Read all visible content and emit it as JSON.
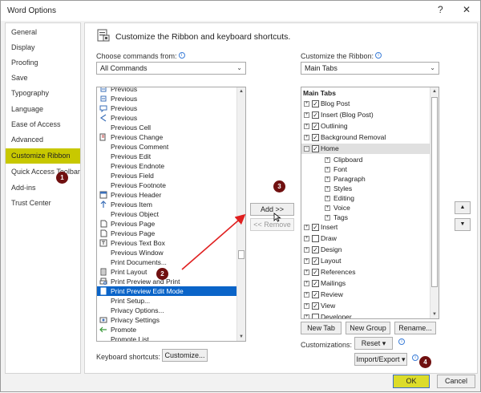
{
  "window": {
    "title": "Word Options",
    "help_label": "?",
    "close_label": "✕"
  },
  "nav": {
    "items": [
      {
        "label": "General"
      },
      {
        "label": "Display"
      },
      {
        "label": "Proofing"
      },
      {
        "label": "Save"
      },
      {
        "label": "Typography"
      },
      {
        "label": "Language"
      },
      {
        "label": "Ease of Access"
      },
      {
        "label": "Advanced"
      },
      {
        "label": "Customize Ribbon",
        "active": true
      },
      {
        "label": "Quick Access Toolbar"
      },
      {
        "label": "Add-ins"
      },
      {
        "label": "Trust Center"
      }
    ]
  },
  "header": {
    "title": "Customize the Ribbon and keyboard shortcuts."
  },
  "left": {
    "label": "Choose commands from:",
    "dropdown_value": "All Commands",
    "commands": [
      {
        "label": "Previous",
        "icon": "prev-icon"
      },
      {
        "label": "Previous",
        "icon": "prev-icon"
      },
      {
        "label": "Previous",
        "icon": "comment-prev-icon"
      },
      {
        "label": "Previous",
        "icon": "triangle-prev-icon"
      },
      {
        "label": "Previous Cell",
        "icon": ""
      },
      {
        "label": "Previous Change",
        "icon": "change-prev-icon"
      },
      {
        "label": "Previous Comment",
        "icon": ""
      },
      {
        "label": "Previous Edit",
        "icon": ""
      },
      {
        "label": "Previous Endnote",
        "icon": ""
      },
      {
        "label": "Previous Field",
        "icon": ""
      },
      {
        "label": "Previous Footnote",
        "icon": ""
      },
      {
        "label": "Previous Header",
        "icon": "header-prev-icon"
      },
      {
        "label": "Previous Item",
        "icon": "up-arrow-icon"
      },
      {
        "label": "Previous Object",
        "icon": ""
      },
      {
        "label": "Previous Page",
        "icon": "page-icon"
      },
      {
        "label": "Previous Page",
        "icon": "page-icon"
      },
      {
        "label": "Previous Text Box",
        "icon": "textbox-icon"
      },
      {
        "label": "Previous Window",
        "icon": ""
      },
      {
        "label": "Print Documents...",
        "icon": ""
      },
      {
        "label": "Print Layout",
        "icon": "layout-icon"
      },
      {
        "label": "Print Preview and Print",
        "icon": "print-preview-icon"
      },
      {
        "label": "Print Preview Edit Mode",
        "icon": "edit-mode-icon",
        "selected": true
      },
      {
        "label": "Print Setup...",
        "icon": ""
      },
      {
        "label": "Privacy Options...",
        "icon": ""
      },
      {
        "label": "Privacy Settings",
        "icon": "privacy-icon"
      },
      {
        "label": "Promote",
        "icon": "left-arrow-icon"
      },
      {
        "label": "Promote List",
        "icon": ""
      }
    ],
    "shortcuts_label": "Keyboard shortcuts:",
    "customize_button": "Customize..."
  },
  "middle": {
    "add_button": "Add >>",
    "remove_button": "<< Remove"
  },
  "right": {
    "label": "Customize the Ribbon:",
    "dropdown_value": "Main Tabs",
    "tree_header": "Main Tabs",
    "tabs": [
      {
        "label": "Blog Post",
        "checked": true,
        "expander": "+"
      },
      {
        "label": "Insert (Blog Post)",
        "checked": true,
        "expander": "+"
      },
      {
        "label": "Outlining",
        "checked": true,
        "expander": "+"
      },
      {
        "label": "Background Removal",
        "checked": true,
        "expander": "+"
      },
      {
        "label": "Home",
        "checked": true,
        "expander": "−",
        "highlight": true
      }
    ],
    "home_groups": [
      {
        "label": "Clipboard"
      },
      {
        "label": "Font"
      },
      {
        "label": "Paragraph"
      },
      {
        "label": "Styles"
      },
      {
        "label": "Editing"
      },
      {
        "label": "Voice"
      },
      {
        "label": "Tags"
      }
    ],
    "tabs_after": [
      {
        "label": "Insert",
        "checked": true
      },
      {
        "label": "Draw",
        "checked": false
      },
      {
        "label": "Design",
        "checked": true
      },
      {
        "label": "Layout",
        "checked": true
      },
      {
        "label": "References",
        "checked": true
      },
      {
        "label": "Mailings",
        "checked": true
      },
      {
        "label": "Review",
        "checked": true
      },
      {
        "label": "View",
        "checked": true
      },
      {
        "label": "Developer",
        "checked": false
      }
    ],
    "new_tab_button": "New Tab",
    "new_group_button": "New Group",
    "rename_button": "Rename...",
    "customizations_label": "Customizations:",
    "reset_button": "Reset",
    "import_export_button": "Import/Export"
  },
  "footer": {
    "ok_button": "OK",
    "cancel_button": "Cancel"
  },
  "markers": [
    "1",
    "2",
    "3",
    "4"
  ],
  "colors": {
    "highlight_yellow": "#c8c800",
    "selection_blue": "#0a64c8",
    "marker": "#701010",
    "arrow_red": "#e02020"
  }
}
